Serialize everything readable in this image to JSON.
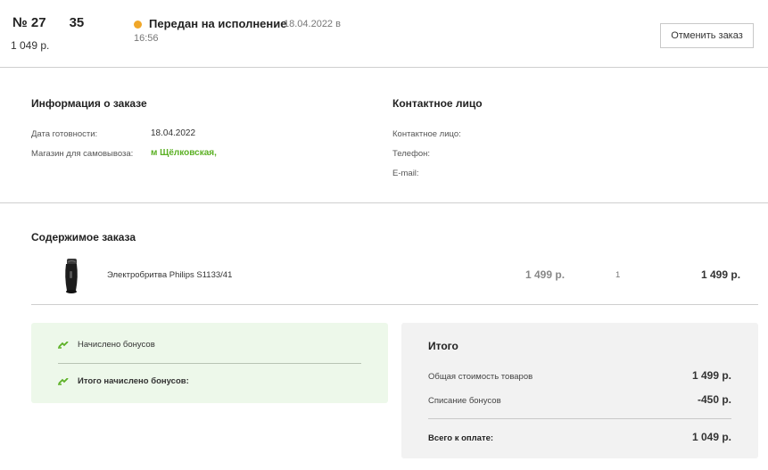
{
  "order": {
    "number_prefix": "№ 27",
    "number_suffix": "35",
    "total": "1 049 р.",
    "status": "Передан на исполнение",
    "status_date": "18.04.2022 в",
    "status_time": "16:56",
    "status_color": "#f0a729",
    "cancel_label": "Отменить заказ"
  },
  "info": {
    "title": "Информация о заказе",
    "ready_date_label": "Дата готовности:",
    "ready_date_value": "18.04.2022",
    "pickup_store_label": "Магазин для самовывоза:",
    "pickup_store_value": "м Щёлковская,"
  },
  "contact": {
    "title": "Контактное лицо",
    "person_label": "Контактное лицо:",
    "phone_label": "Телефон:",
    "email_label": "E-mail:"
  },
  "contents": {
    "title": "Содержимое заказа",
    "items": [
      {
        "icon": "shaver-image",
        "name": "Электробритва Philips S1133/41",
        "price": "1 499 р.",
        "quantity": "1",
        "sum": "1 499 р."
      }
    ]
  },
  "bonus": {
    "accrued_label": "Начислено бонусов",
    "total_accrued_label": "Итого начислено бонусов:",
    "icon": "bonus-arrow-icon",
    "accent_color": "#5bb024"
  },
  "totals": {
    "title": "Итого",
    "goods_cost_label": "Общая стоимость товаров",
    "goods_cost_value": "1 499 р.",
    "bonus_writeoff_label": "Списание бонусов",
    "bonus_writeoff_value": "-450 р.",
    "to_pay_label": "Всего к оплате:",
    "to_pay_value": "1 049 р."
  }
}
